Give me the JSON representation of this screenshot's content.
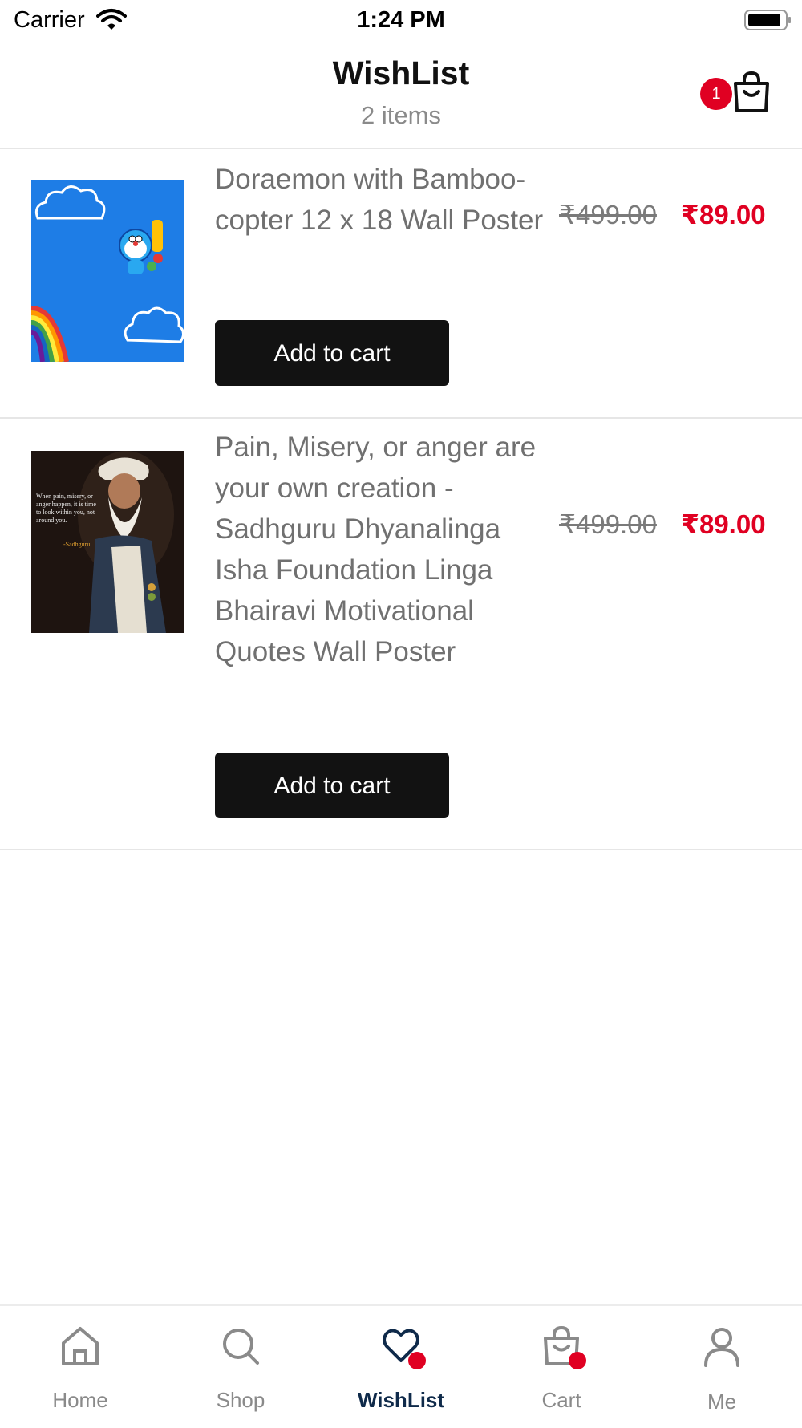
{
  "status_bar": {
    "carrier": "Carrier",
    "time": "1:24 PM"
  },
  "header": {
    "title": "WishList",
    "subtitle": "2 items",
    "cart_count": "1"
  },
  "items": [
    {
      "name": "Doraemon with Bamboo-copter 12 x 18 Wall Poster",
      "price_old": "₹499.00",
      "price_new": "₹89.00",
      "button": "Add to cart"
    },
    {
      "name": "Pain, Misery, or anger are your own creation - Sadhguru Dhyanalinga Isha Foundation Linga Bhairavi Motivational Quotes Wall Poster",
      "price_old": "₹499.00",
      "price_new": "₹89.00",
      "button": "Add to cart",
      "image_quote": "When pain, misery, or anger happen, it is time to look within you, not around you.",
      "image_author": "-Sadhguru"
    }
  ],
  "tabs": [
    {
      "label": "Home",
      "icon": "home-icon"
    },
    {
      "label": "Shop",
      "icon": "search-icon"
    },
    {
      "label": "WishList",
      "icon": "heart-icon",
      "active": true
    },
    {
      "label": "Cart",
      "icon": "cart-bag-icon"
    },
    {
      "label": "Me",
      "icon": "user-icon"
    }
  ],
  "colors": {
    "accent": "#e00022",
    "active_tab": "#0f2a4a",
    "button": "#121212"
  }
}
